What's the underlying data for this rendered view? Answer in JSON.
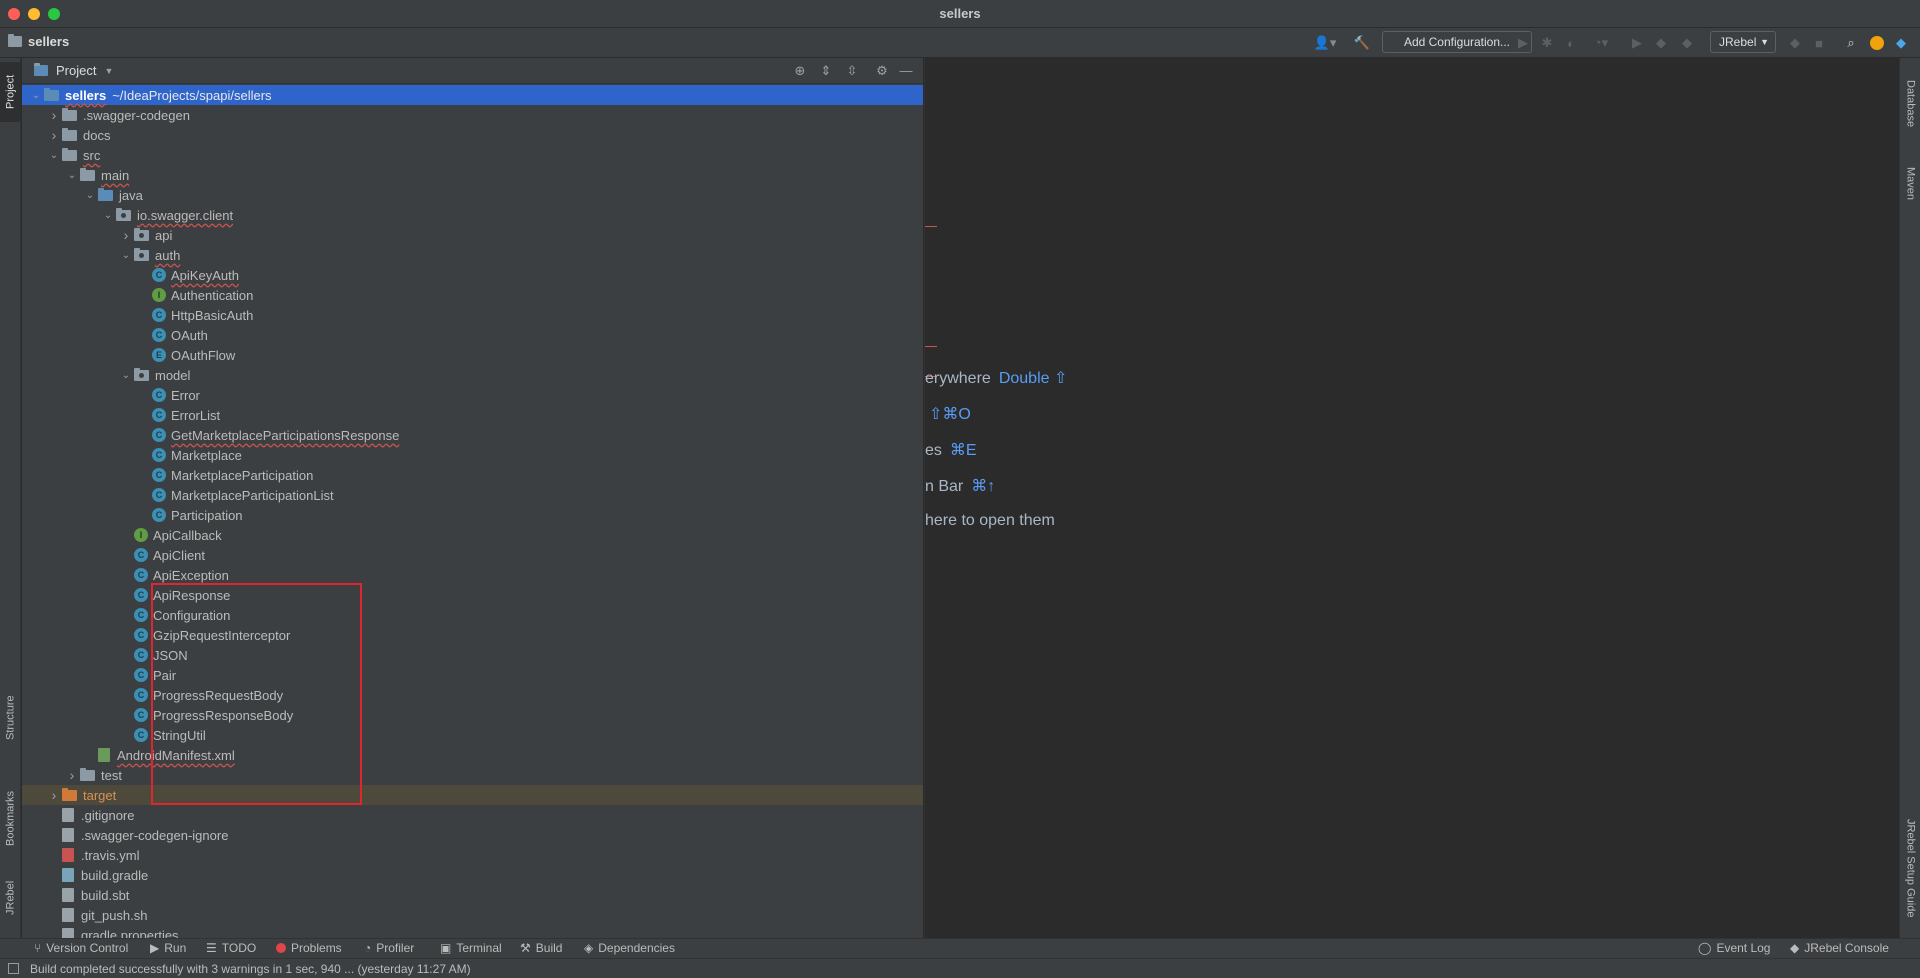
{
  "window": {
    "title": "sellers"
  },
  "navbar": {
    "project_name": "sellers",
    "add_configuration": "Add Configuration...",
    "jrebel_select": "JRebel"
  },
  "left_strip": {
    "project": "Project",
    "structure": "Structure",
    "bookmarks": "Bookmarks",
    "jrebel": "JRebel"
  },
  "right_strip": {
    "database": "Database",
    "maven": "Maven",
    "jrebel_guide": "JRebel Setup Guide"
  },
  "panel": {
    "title": "Project"
  },
  "tree": [
    {
      "label": "sellers",
      "suffix": "~/IdeaProjects/spapi/sellers",
      "depth": 0,
      "arrow": "open",
      "icon": "folder-blue"
    },
    {
      "label": ".swagger-codegen",
      "depth": 1,
      "arrow": "closed",
      "icon": "folder"
    },
    {
      "label": "docs",
      "depth": 1,
      "arrow": "closed",
      "icon": "folder"
    },
    {
      "label": "src",
      "depth": 1,
      "arrow": "open",
      "icon": "folder"
    },
    {
      "label": "main",
      "depth": 2,
      "arrow": "open",
      "icon": "folder"
    },
    {
      "label": "java",
      "depth": 3,
      "arrow": "open",
      "icon": "folder-blue"
    },
    {
      "label": "io.swagger.client",
      "depth": 4,
      "arrow": "open",
      "icon": "package"
    },
    {
      "label": "api",
      "depth": 5,
      "arrow": "closed",
      "icon": "package"
    },
    {
      "label": "auth",
      "depth": 5,
      "arrow": "open",
      "icon": "package"
    },
    {
      "label": "ApiKeyAuth",
      "depth": 6,
      "icon": "class"
    },
    {
      "label": "Authentication",
      "depth": 6,
      "icon": "interface"
    },
    {
      "label": "HttpBasicAuth",
      "depth": 6,
      "icon": "class"
    },
    {
      "label": "OAuth",
      "depth": 6,
      "icon": "class"
    },
    {
      "label": "OAuthFlow",
      "depth": 6,
      "icon": "enum"
    },
    {
      "label": "model",
      "depth": 5,
      "arrow": "open",
      "icon": "package"
    },
    {
      "label": "Error",
      "depth": 6,
      "icon": "class"
    },
    {
      "label": "ErrorList",
      "depth": 6,
      "icon": "class"
    },
    {
      "label": "GetMarketplaceParticipationsResponse",
      "depth": 6,
      "icon": "class"
    },
    {
      "label": "Marketplace",
      "depth": 6,
      "icon": "class"
    },
    {
      "label": "MarketplaceParticipation",
      "depth": 6,
      "icon": "class"
    },
    {
      "label": "MarketplaceParticipationList",
      "depth": 6,
      "icon": "class"
    },
    {
      "label": "Participation",
      "depth": 6,
      "icon": "class"
    },
    {
      "label": "ApiCallback",
      "depth": 5,
      "icon": "interface"
    },
    {
      "label": "ApiClient",
      "depth": 5,
      "icon": "class"
    },
    {
      "label": "ApiException",
      "depth": 5,
      "icon": "class"
    },
    {
      "label": "ApiResponse",
      "depth": 5,
      "icon": "class"
    },
    {
      "label": "Configuration",
      "depth": 5,
      "icon": "class"
    },
    {
      "label": "GzipRequestInterceptor",
      "depth": 5,
      "icon": "class"
    },
    {
      "label": "JSON",
      "depth": 5,
      "icon": "class"
    },
    {
      "label": "Pair",
      "depth": 5,
      "icon": "class"
    },
    {
      "label": "ProgressRequestBody",
      "depth": 5,
      "icon": "class"
    },
    {
      "label": "ProgressResponseBody",
      "depth": 5,
      "icon": "class"
    },
    {
      "label": "StringUtil",
      "depth": 5,
      "icon": "class"
    },
    {
      "label": "AndroidManifest.xml",
      "depth": 3,
      "icon": "file-xml"
    },
    {
      "label": "test",
      "depth": 2,
      "arrow": "closed",
      "icon": "folder"
    },
    {
      "label": "target",
      "depth": 1,
      "arrow": "closed",
      "icon": "folder-orange"
    },
    {
      "label": ".gitignore",
      "depth": 1,
      "icon": "file"
    },
    {
      "label": ".swagger-codegen-ignore",
      "depth": 1,
      "icon": "file"
    },
    {
      "label": ".travis.yml",
      "depth": 1,
      "icon": "file-yml"
    },
    {
      "label": "build.gradle",
      "depth": 1,
      "icon": "file-gradle"
    },
    {
      "label": "build.sbt",
      "depth": 1,
      "icon": "file"
    },
    {
      "label": "git_push.sh",
      "depth": 1,
      "icon": "file"
    },
    {
      "label": "gradle.properties",
      "depth": 1,
      "icon": "file"
    }
  ],
  "editor_hints": [
    {
      "text": "erywhere",
      "key": "Double ⇧"
    },
    {
      "text": "",
      "key": "⇧⌘O"
    },
    {
      "text": "es",
      "key": "⌘E"
    },
    {
      "text": "n Bar",
      "key": "⌘↑"
    },
    {
      "text": "here to open them",
      "key": ""
    }
  ],
  "bottom_tabs": {
    "version_control": "Version Control",
    "run": "Run",
    "todo": "TODO",
    "problems": "Problems",
    "profiler": "Profiler",
    "terminal": "Terminal",
    "build": "Build",
    "dependencies": "Dependencies",
    "event_log": "Event Log",
    "jrebel_console": "JRebel Console"
  },
  "status": {
    "message": "Build completed successfully with 3 warnings in 1 sec, 940 ... (yesterday 11:27 AM)"
  },
  "colors": {
    "selection": "#2f65ca",
    "highlight_box": "#e0252e",
    "accent_link": "#589df6"
  }
}
